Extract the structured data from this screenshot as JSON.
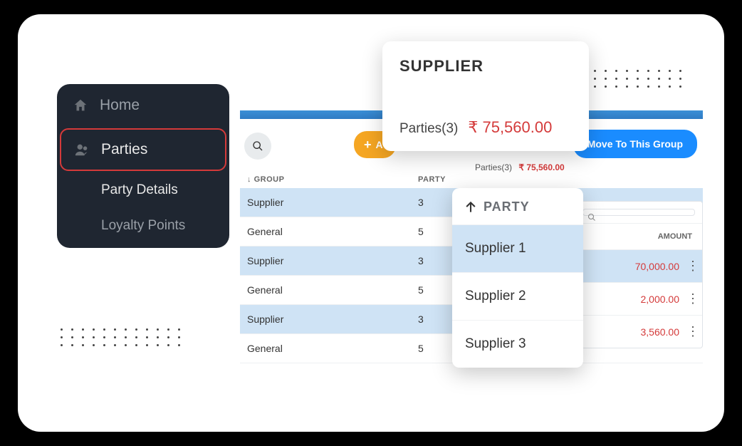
{
  "sidebar": {
    "items": [
      {
        "label": "Home"
      },
      {
        "label": "Parties"
      },
      {
        "label": "Party Details"
      },
      {
        "label": "Loyalty Points"
      }
    ]
  },
  "toolbar": {
    "add_label": "A",
    "move_label": "Move To This Group"
  },
  "table": {
    "header_group": "GROUP",
    "header_party": "PARTY",
    "rows": [
      {
        "group": "Supplier",
        "party": "3"
      },
      {
        "group": "General",
        "party": "5"
      },
      {
        "group": "Supplier",
        "party": "3"
      },
      {
        "group": "General",
        "party": "5"
      },
      {
        "group": "Supplier",
        "party": "3"
      },
      {
        "group": "General",
        "party": "5"
      }
    ]
  },
  "supplier_card": {
    "title": "SUPPLIER",
    "parties_label": "Parties(3)",
    "amount": "₹ 75,560.00"
  },
  "detail_summary": {
    "parties_label": "Parties(3)",
    "amount": "₹ 75,560.00"
  },
  "right_table": {
    "header_amount": "AMOUNT",
    "search_placeholder": "",
    "rows": [
      {
        "amount": "70,000.00"
      },
      {
        "amount": "2,000.00"
      },
      {
        "amount": "3,560.00"
      }
    ]
  },
  "party_popup": {
    "header": "PARTY",
    "items": [
      {
        "label": "Supplier 1"
      },
      {
        "label": "Supplier 2"
      },
      {
        "label": "Supplier 3"
      }
    ]
  }
}
